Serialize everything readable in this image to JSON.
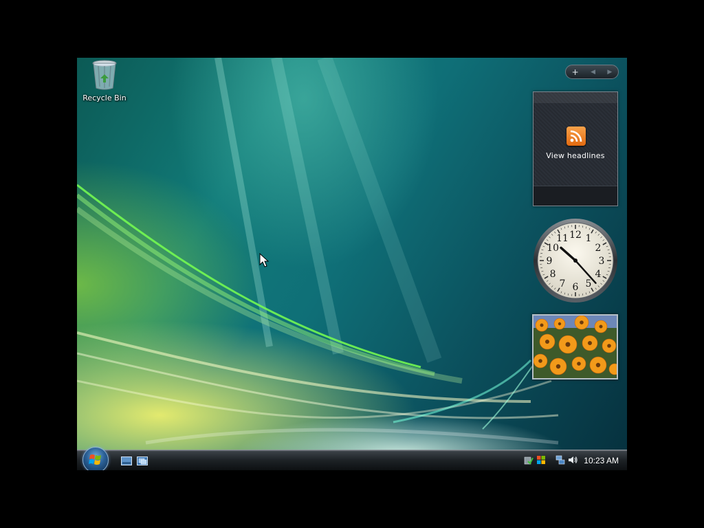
{
  "desktop": {
    "icons": [
      {
        "label": "Recycle Bin",
        "icon": "recycle-bin-icon"
      }
    ]
  },
  "sidebar": {
    "controls": {
      "add": "+",
      "prev": "◀",
      "next": "▶"
    },
    "feed_gadget": {
      "label": "View headlines",
      "icon": "rss-icon"
    },
    "clock_gadget": {
      "numbers": [
        "12",
        "1",
        "2",
        "3",
        "4",
        "5",
        "6",
        "7",
        "8",
        "9",
        "10",
        "11"
      ],
      "time": "10:23"
    },
    "slideshow_gadget": {
      "subject": "orange-flowers"
    }
  },
  "taskbar": {
    "start_icon": "windows-logo-icon",
    "quick_launch": [
      "show-desktop-icon",
      "switch-windows-icon"
    ],
    "tray_icons": [
      "windows-defender-icon",
      "windows-flag-icon",
      "network-icon",
      "volume-icon"
    ],
    "clock": "10:23 AM"
  },
  "colors": {
    "taskbar": "#1d2226",
    "wallpaper_teal": "#117b79",
    "wallpaper_yellow": "#eef06e",
    "rss_orange": "#f28a2a"
  }
}
